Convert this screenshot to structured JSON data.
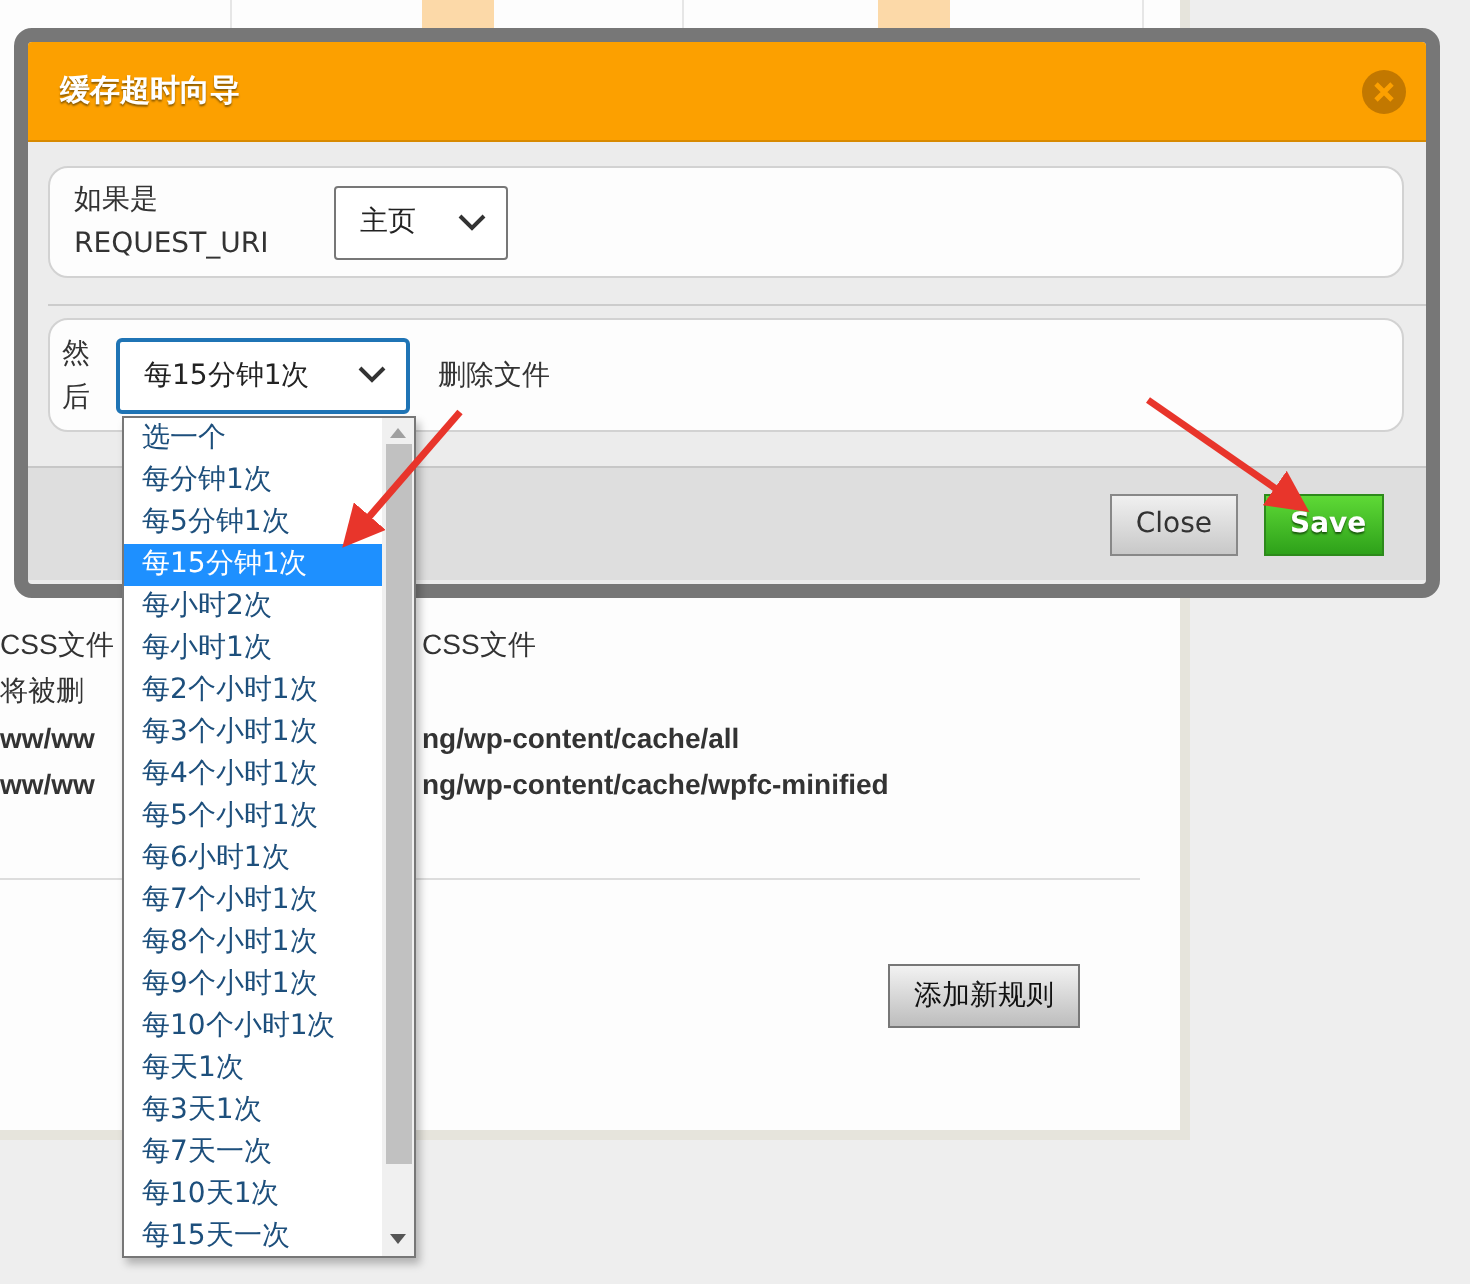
{
  "background_page": {
    "rows": [
      {
        "left": "CSS文件",
        "right": "CSS文件",
        "bold": false
      },
      {
        "left": "将被删",
        "bold": false
      },
      {
        "left": "ww/ww",
        "right": "ng/wp-content/cache/all",
        "bold": true
      },
      {
        "left": "ww/ww",
        "right": "ng/wp-content/cache/wpfc-minified",
        "bold": true
      }
    ],
    "add_rule_button": "添加新规则"
  },
  "dialog": {
    "title": "缓存超时向导",
    "if_row": {
      "label_lines": [
        "如果是",
        "REQUEST_URI"
      ],
      "select_value": "主页"
    },
    "then_row": {
      "label_lines": [
        "然",
        "后"
      ],
      "select_value": "每15分钟1次",
      "action": "删除文件"
    },
    "dropdown": {
      "options": [
        {
          "label": "选一个",
          "selected": false
        },
        {
          "label": "每分钟1次",
          "selected": false
        },
        {
          "label": "每5分钟1次",
          "selected": false
        },
        {
          "label": "每15分钟1次",
          "selected": true
        },
        {
          "label": "每小时2次",
          "selected": false
        },
        {
          "label": "每小时1次",
          "selected": false
        },
        {
          "label": "每2个小时1次",
          "selected": false
        },
        {
          "label": "每3个小时1次",
          "selected": false
        },
        {
          "label": "每4个小时1次",
          "selected": false
        },
        {
          "label": "每5个小时1次",
          "selected": false
        },
        {
          "label": "每6小时1次",
          "selected": false
        },
        {
          "label": "每7个小时1次",
          "selected": false
        },
        {
          "label": "每8个小时1次",
          "selected": false
        },
        {
          "label": "每9个小时1次",
          "selected": false
        },
        {
          "label": "每10个小时1次",
          "selected": false
        },
        {
          "label": "每天1次",
          "selected": false
        },
        {
          "label": "每3天1次",
          "selected": false
        },
        {
          "label": "每7天一次",
          "selected": false
        },
        {
          "label": "每10天1次",
          "selected": false
        },
        {
          "label": "每15天一次",
          "selected": false
        }
      ]
    },
    "buttons": [
      {
        "label": "Close",
        "kind": "secondary"
      },
      {
        "label": "Save",
        "kind": "primary"
      }
    ]
  }
}
